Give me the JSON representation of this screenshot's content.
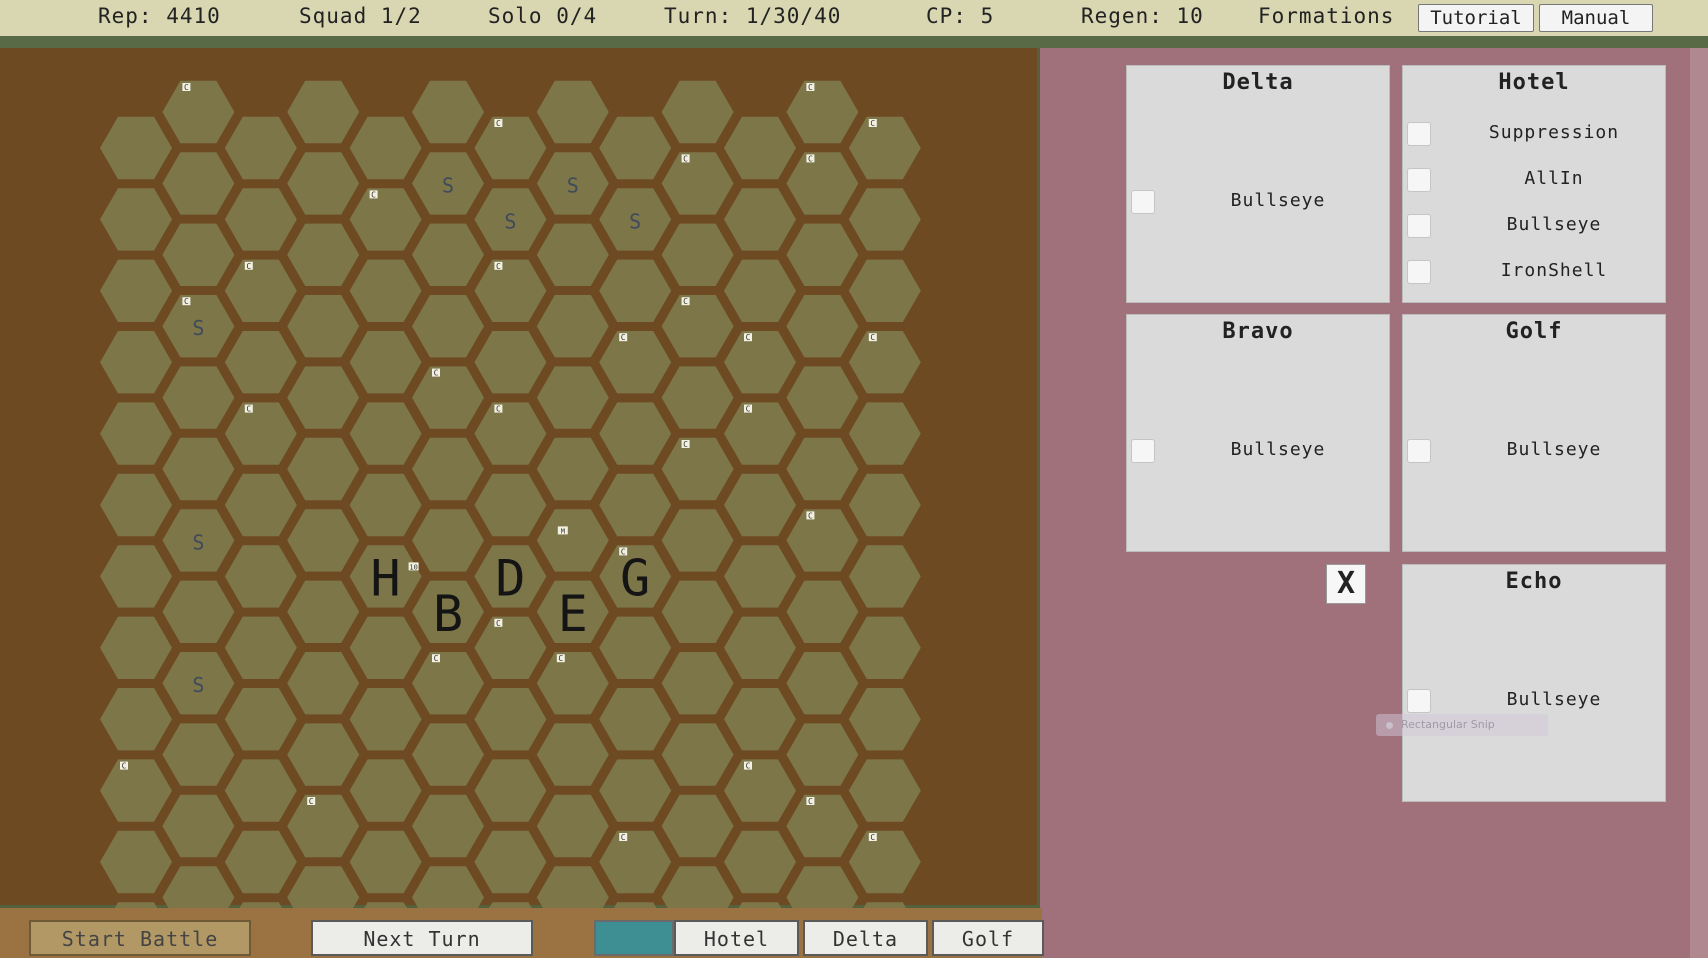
{
  "topbar": {
    "rep": "Rep: 4410",
    "squad": "Squad 1/2",
    "solo": "Solo 0/4",
    "turn": "Turn: 1/30/40",
    "cp": "CP: 5",
    "regen": "Regen: 10",
    "formations": "Formations",
    "tutorial_label": "Tutorial",
    "manual_label": "Manual"
  },
  "board": {
    "columns": 13,
    "rows": 12,
    "hex_color": "#7d7649",
    "board_color": "#6e4a22",
    "units": [
      {
        "label": "H",
        "col": 4,
        "row": 6
      },
      {
        "label": "D",
        "col": 6,
        "row": 6
      },
      {
        "label": "G",
        "col": 8,
        "row": 6
      },
      {
        "label": "B",
        "col": 5,
        "row": 7
      },
      {
        "label": "E",
        "col": 7,
        "row": 7
      }
    ],
    "s_markers": [
      {
        "label": "S",
        "col": 5,
        "row": 1
      },
      {
        "label": "S",
        "col": 7,
        "row": 1
      },
      {
        "label": "S",
        "col": 6,
        "row": 1
      },
      {
        "label": "S",
        "col": 8,
        "row": 1
      },
      {
        "label": "S",
        "col": 1,
        "row": 3
      },
      {
        "label": "S",
        "col": 1,
        "row": 6
      },
      {
        "label": "S",
        "col": 1,
        "row": 8
      }
    ],
    "c_markers": [
      {
        "label": "C",
        "col": 1,
        "row": 0
      },
      {
        "label": "C",
        "col": 6,
        "row": 0
      },
      {
        "label": "C",
        "col": 11,
        "row": 0
      },
      {
        "label": "C",
        "col": 12,
        "row": 0
      },
      {
        "label": "C",
        "col": 11,
        "row": 1
      },
      {
        "label": "C",
        "col": 4,
        "row": 1
      },
      {
        "label": "C",
        "col": 9,
        "row": 1
      },
      {
        "label": "C",
        "col": 2,
        "row": 2
      },
      {
        "label": "C",
        "col": 6,
        "row": 2
      },
      {
        "label": "C",
        "col": 1,
        "row": 3
      },
      {
        "label": "C",
        "col": 9,
        "row": 3
      },
      {
        "label": "C",
        "col": 8,
        "row": 3
      },
      {
        "label": "C",
        "col": 10,
        "row": 3
      },
      {
        "label": "C",
        "col": 12,
        "row": 3
      },
      {
        "label": "C",
        "col": 5,
        "row": 4
      },
      {
        "label": "C",
        "col": 2,
        "row": 4
      },
      {
        "label": "C",
        "col": 6,
        "row": 4
      },
      {
        "label": "C",
        "col": 10,
        "row": 4
      },
      {
        "label": "C",
        "col": 9,
        "row": 5
      },
      {
        "label": "C",
        "col": 8,
        "row": 6
      },
      {
        "label": "C",
        "col": 11,
        "row": 6
      },
      {
        "label": "C",
        "col": 6,
        "row": 7
      },
      {
        "label": "C",
        "col": 5,
        "row": 8
      },
      {
        "label": "C",
        "col": 7,
        "row": 8
      },
      {
        "label": "C",
        "col": 0,
        "row": 9
      },
      {
        "label": "C",
        "col": 10,
        "row": 9
      },
      {
        "label": "C",
        "col": 8,
        "row": 10
      },
      {
        "label": "C",
        "col": 12,
        "row": 10
      },
      {
        "label": "C",
        "col": 3,
        "row": 10
      },
      {
        "label": "C",
        "col": 11,
        "row": 10
      }
    ],
    "tag_markers": [
      {
        "label": "M",
        "col": 7,
        "row": 6
      },
      {
        "label": "10",
        "col": 4,
        "row": 6
      }
    ]
  },
  "bottombar": {
    "start_battle": "Start Battle",
    "next_turn": "Next Turn",
    "tabs": [
      {
        "label": ""
      },
      {
        "label": "Hotel"
      },
      {
        "label": "Delta"
      },
      {
        "label": "Golf"
      }
    ]
  },
  "panels": {
    "delta": {
      "title": "Delta",
      "options": [
        {
          "label": "Bullseye",
          "checked": false
        }
      ]
    },
    "hotel": {
      "title": "Hotel",
      "options": [
        {
          "label": "Suppression",
          "checked": false
        },
        {
          "label": "AllIn",
          "checked": false
        },
        {
          "label": "Bullseye",
          "checked": false
        },
        {
          "label": "IronShell",
          "checked": false
        }
      ]
    },
    "bravo": {
      "title": "Bravo",
      "options": [
        {
          "label": "Bullseye",
          "checked": false
        }
      ]
    },
    "golf": {
      "title": "Golf",
      "options": [
        {
          "label": "Bullseye",
          "checked": false
        }
      ]
    },
    "echo": {
      "title": "Echo",
      "options": [
        {
          "label": "Bullseye",
          "checked": false
        }
      ]
    }
  },
  "close_label": "X",
  "snip_label": "Rectangular Snip"
}
